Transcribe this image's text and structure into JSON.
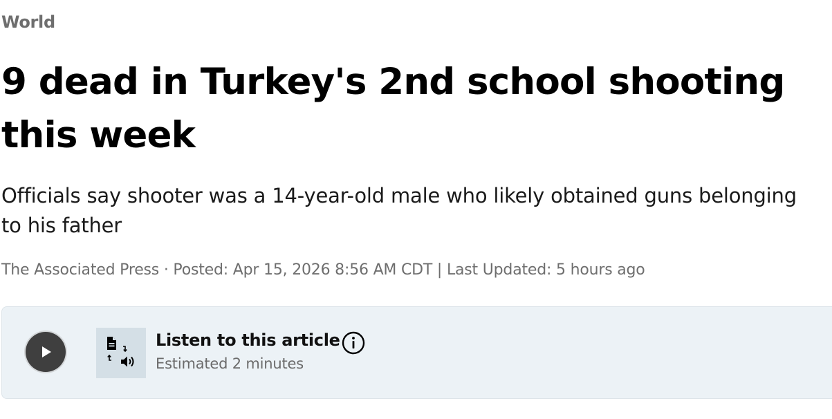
{
  "section": {
    "label": "World"
  },
  "article": {
    "headline": "9 dead in Turkey's 2nd school shooting this week",
    "deck": "Officials say shooter was a 14-year-old male who likely obtained guns belonging to his father",
    "byline": "The Associated Press · Posted: Apr 15, 2026 8:56 AM CDT | Last Updated: 5 hours ago"
  },
  "audio_player": {
    "title": "Listen to this article",
    "subtitle": "Estimated 2 minutes",
    "play_icon": "play-icon",
    "tts_icon": "text-to-speech-icon",
    "info_icon": "info-icon",
    "colors": {
      "card_background": "#ecf2f6",
      "play_button": "#3f3f3f",
      "tts_tile": "#d4dfe6"
    }
  }
}
